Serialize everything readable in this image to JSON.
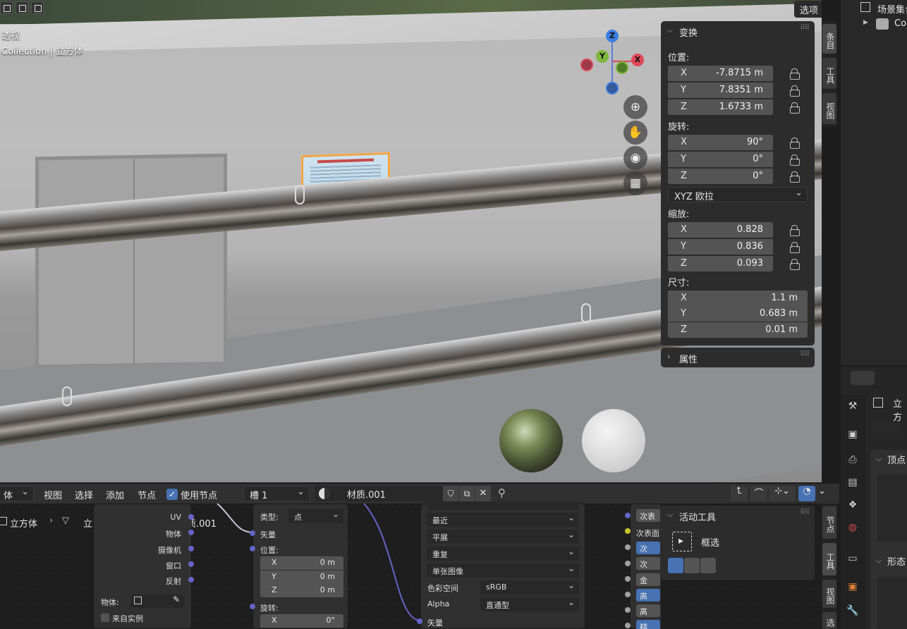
{
  "viewport": {
    "view_mode": "透视",
    "collection_info": "Collection | 立方体",
    "options_label": "选项",
    "gizmo": {
      "z": "Z",
      "y": "Y",
      "x": "X"
    },
    "nav_icons": [
      "zoom-icon",
      "hand-icon",
      "camera-icon",
      "grid-icon"
    ]
  },
  "transform_panel": {
    "title": "变换",
    "location": {
      "label": "位置:",
      "x": "-7.8715 m",
      "y": "7.8351 m",
      "z": "1.6733 m"
    },
    "rotation": {
      "label": "旋转:",
      "x": "90°",
      "y": "0°",
      "z": "0°"
    },
    "rotation_mode": "XYZ 欧拉",
    "scale": {
      "label": "缩放:",
      "x": "0.828",
      "y": "0.836",
      "z": "0.093"
    },
    "dimensions": {
      "label": "尺寸:",
      "x": "1.1 m",
      "y": "0.683 m",
      "z": "0.01 m"
    },
    "axis_x": "X",
    "axis_y": "Y",
    "axis_z": "Z"
  },
  "properties_panel": {
    "title": "属性"
  },
  "sidebar_tabs_top": [
    "条目",
    "工具",
    "视图"
  ],
  "sidebar_tabs_bottom": [
    "节点",
    "工具",
    "视图",
    "选"
  ],
  "outliner": {
    "scene_collection": "场景集合",
    "collection": "Co"
  },
  "props_editor": {
    "object_name": "立方",
    "vertex_label": "顶点",
    "shape_label": "形态"
  },
  "node_header": {
    "mode": "体",
    "menu": [
      "视图",
      "选择",
      "添加",
      "节点"
    ],
    "use_nodes_label": "使用节点",
    "slot": "槽 1",
    "material": "材质.001"
  },
  "breadcrumb": {
    "object": "立方体",
    "mesh": "立方体.001",
    "material": "材质.001"
  },
  "nodes": {
    "texcoord": {
      "outputs": [
        "UV",
        "物体",
        "摄像机",
        "窗口",
        "反射"
      ],
      "object_label": "物体:",
      "from_instancer": "来自实例"
    },
    "mapping": {
      "type_label": "类型:",
      "type_value": "点",
      "vector": "矢量",
      "location": "位置:",
      "lx": "0 m",
      "ly": "0 m",
      "lz": "0 m",
      "rotation": "旋转:",
      "rx": "0°"
    },
    "image": {
      "interp": "最近",
      "projection": "平展",
      "extension": "重复",
      "source": "单张图像",
      "colorspace_label": "色彩空间",
      "colorspace": "sRGB",
      "alpha_label": "Alpha",
      "alpha": "直通型",
      "vector": "矢量"
    },
    "bsdf": {
      "sub1": "次表",
      "sub2": "次表面",
      "b1": "次",
      "b2": "次",
      "b3": "金",
      "b4": "高",
      "b5": "高",
      "b6": "糙"
    }
  },
  "active_tool": {
    "title": "活动工具",
    "tool_name": "框选"
  }
}
